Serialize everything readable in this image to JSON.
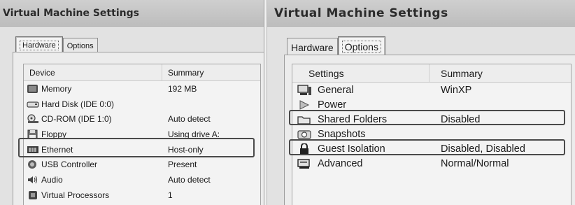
{
  "left_window": {
    "title": "Virtual Machine Settings",
    "tabs": [
      {
        "label": "Hardware",
        "selected": true
      },
      {
        "label": "Options",
        "selected": false
      }
    ],
    "columns": {
      "device": "Device",
      "summary": "Summary"
    },
    "rows": [
      {
        "icon": "memory-icon",
        "name": "Memory",
        "summary": "192 MB"
      },
      {
        "icon": "hard-disk-icon",
        "name": "Hard Disk (IDE 0:0)",
        "summary": ""
      },
      {
        "icon": "cdrom-icon",
        "name": "CD-ROM (IDE 1:0)",
        "summary": "Auto detect"
      },
      {
        "icon": "floppy-icon",
        "name": "Floppy",
        "summary": "Using drive A:"
      },
      {
        "icon": "ethernet-icon",
        "name": "Ethernet",
        "summary": "Host-only",
        "highlighted": true
      },
      {
        "icon": "usb-controller-icon",
        "name": "USB Controller",
        "summary": "Present"
      },
      {
        "icon": "audio-icon",
        "name": "Audio",
        "summary": "Auto detect"
      },
      {
        "icon": "processor-icon",
        "name": "Virtual Processors",
        "summary": "1"
      }
    ]
  },
  "right_window": {
    "title": "Virtual Machine Settings",
    "tabs": [
      {
        "label": "Hardware",
        "selected": false
      },
      {
        "label": "Options",
        "selected": true
      }
    ],
    "columns": {
      "settings": "Settings",
      "summary": "Summary"
    },
    "rows": [
      {
        "icon": "general-icon",
        "name": "General",
        "summary": "WinXP"
      },
      {
        "icon": "power-icon",
        "name": "Power",
        "summary": ""
      },
      {
        "icon": "shared-folders-icon",
        "name": "Shared Folders",
        "summary": "Disabled",
        "highlighted": true
      },
      {
        "icon": "snapshots-icon",
        "name": "Snapshots",
        "summary": ""
      },
      {
        "icon": "guest-isolation-icon",
        "name": "Guest Isolation",
        "summary": "Disabled, Disabled",
        "highlighted": true
      },
      {
        "icon": "advanced-icon",
        "name": "Advanced",
        "summary": "Normal/Normal"
      }
    ]
  },
  "colors": {
    "highlight_border": "#4a4a4a",
    "titlebar": "#c6c6c6"
  }
}
